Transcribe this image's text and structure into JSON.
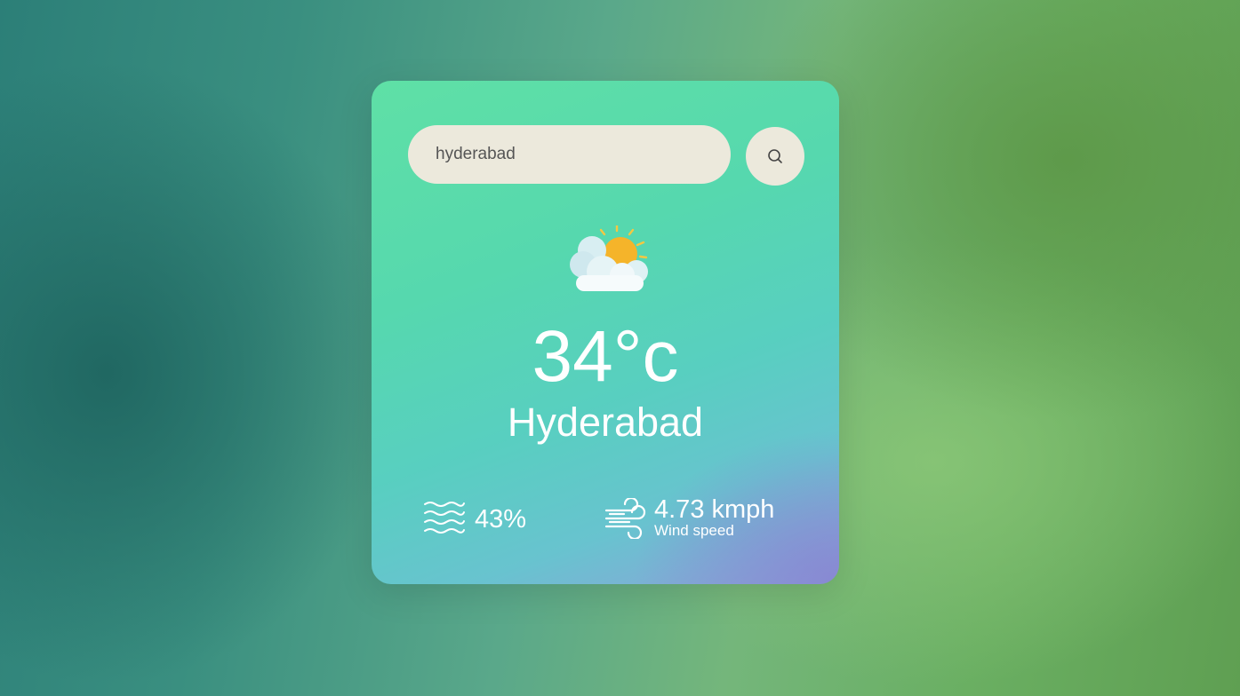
{
  "search": {
    "value": "hyderabad",
    "button_icon": "search-icon"
  },
  "weather": {
    "icon": "partly-cloudy-icon",
    "temperature": "34°c",
    "city": "Hyderabad",
    "humidity": {
      "icon": "humidity-waves-icon",
      "value": "43%"
    },
    "wind": {
      "icon": "wind-icon",
      "value": "4.73 kmph",
      "label": "Wind speed"
    }
  },
  "colors": {
    "card_top": "#5fe0a6",
    "card_bottom": "#8fa0da",
    "input_bg": "#ece9dc",
    "text": "#ffffff",
    "sun": "#f5b42a"
  }
}
